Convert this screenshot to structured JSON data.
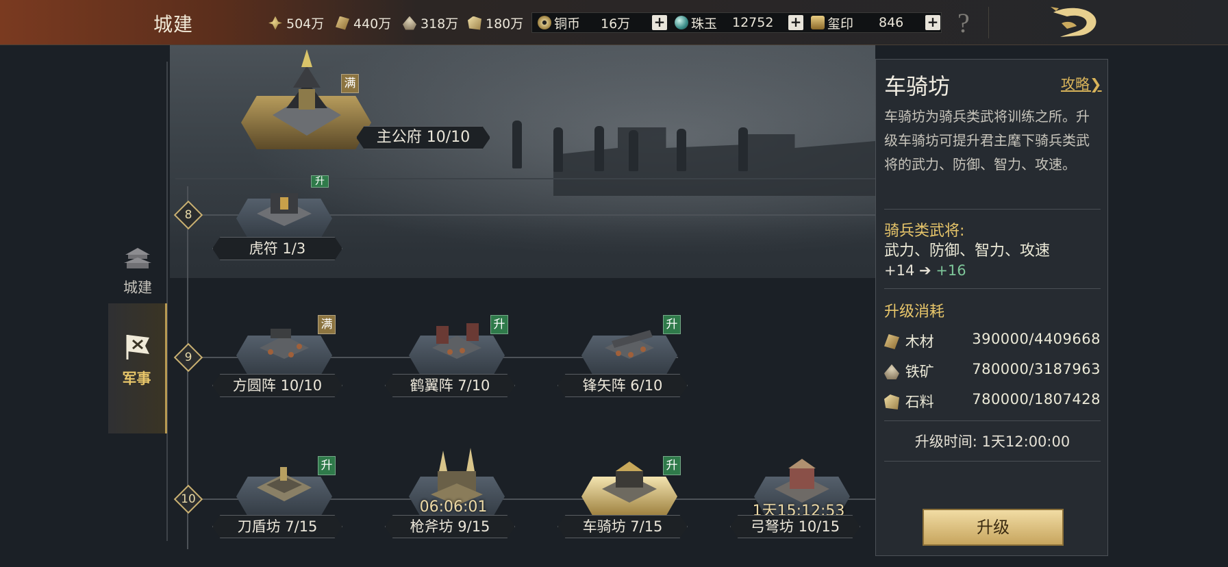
{
  "header": {
    "title": "城建",
    "resources": [
      {
        "icon": "grain-icon",
        "value": "504万"
      },
      {
        "icon": "wood-icon",
        "value": "440万"
      },
      {
        "icon": "iron-icon",
        "value": "318万"
      },
      {
        "icon": "stone-icon",
        "value": "180万"
      }
    ],
    "currencies": [
      {
        "icon": "copper-coin-icon",
        "name": "铜币",
        "value": "16万"
      },
      {
        "icon": "jade-icon",
        "name": "珠玉",
        "value": "12752"
      },
      {
        "icon": "seal-icon",
        "name": "玺印",
        "value": "846"
      }
    ],
    "plus": "+",
    "help": "?"
  },
  "tabs": [
    {
      "label": "城建",
      "active": false
    },
    {
      "label": "军事",
      "active": true
    }
  ],
  "tree": {
    "main": {
      "label": "主公府 10/10",
      "badge": "满"
    },
    "levels": [
      "8",
      "9",
      "10"
    ],
    "row8": [
      {
        "label": "虎符 1/3",
        "badge": "升"
      }
    ],
    "row9": [
      {
        "label": "方圆阵 10/10",
        "badge": "满"
      },
      {
        "label": "鹤翼阵 7/10",
        "badge": "升"
      },
      {
        "label": "锋矢阵 6/10",
        "badge": "升"
      }
    ],
    "row10": [
      {
        "label": "刀盾坊 7/15",
        "badge": "升",
        "timer": ""
      },
      {
        "label": "枪斧坊 9/15",
        "badge": "",
        "timer": "06:06:01"
      },
      {
        "label": "车骑坊 7/15",
        "badge": "升",
        "timer": ""
      },
      {
        "label": "弓弩坊 10/15",
        "badge": "",
        "timer": "1天15:12:53"
      }
    ]
  },
  "panel": {
    "title": "车骑坊",
    "guide": "攻略❯",
    "description": "车骑坊为骑兵类武将训练之所。升级车骑坊可提升君主麾下骑兵类武将的武力、防御、智力、攻速。",
    "bonus_heading": "骑兵类武将:",
    "bonus_stats": "武力、防御、智力、攻速",
    "bonus_from": "+14",
    "bonus_arrow": "➔",
    "bonus_to": "+16",
    "cost_heading": "升级消耗",
    "costs": [
      {
        "icon": "wood-icon",
        "name": "木材",
        "value": "390000/4409668"
      },
      {
        "icon": "iron-icon",
        "name": "铁矿",
        "value": "780000/3187963"
      },
      {
        "icon": "stone-icon",
        "name": "石料",
        "value": "780000/1807428"
      }
    ],
    "time_label": "升级时间:",
    "time_value": "1天12:00:00",
    "upgrade_button": "升级"
  },
  "colors": {
    "accent_gold": "#e8c66a",
    "bonus_green": "#7ec79a",
    "badge_upgrade": "#2f7a4a",
    "badge_max": "#8c7440"
  }
}
